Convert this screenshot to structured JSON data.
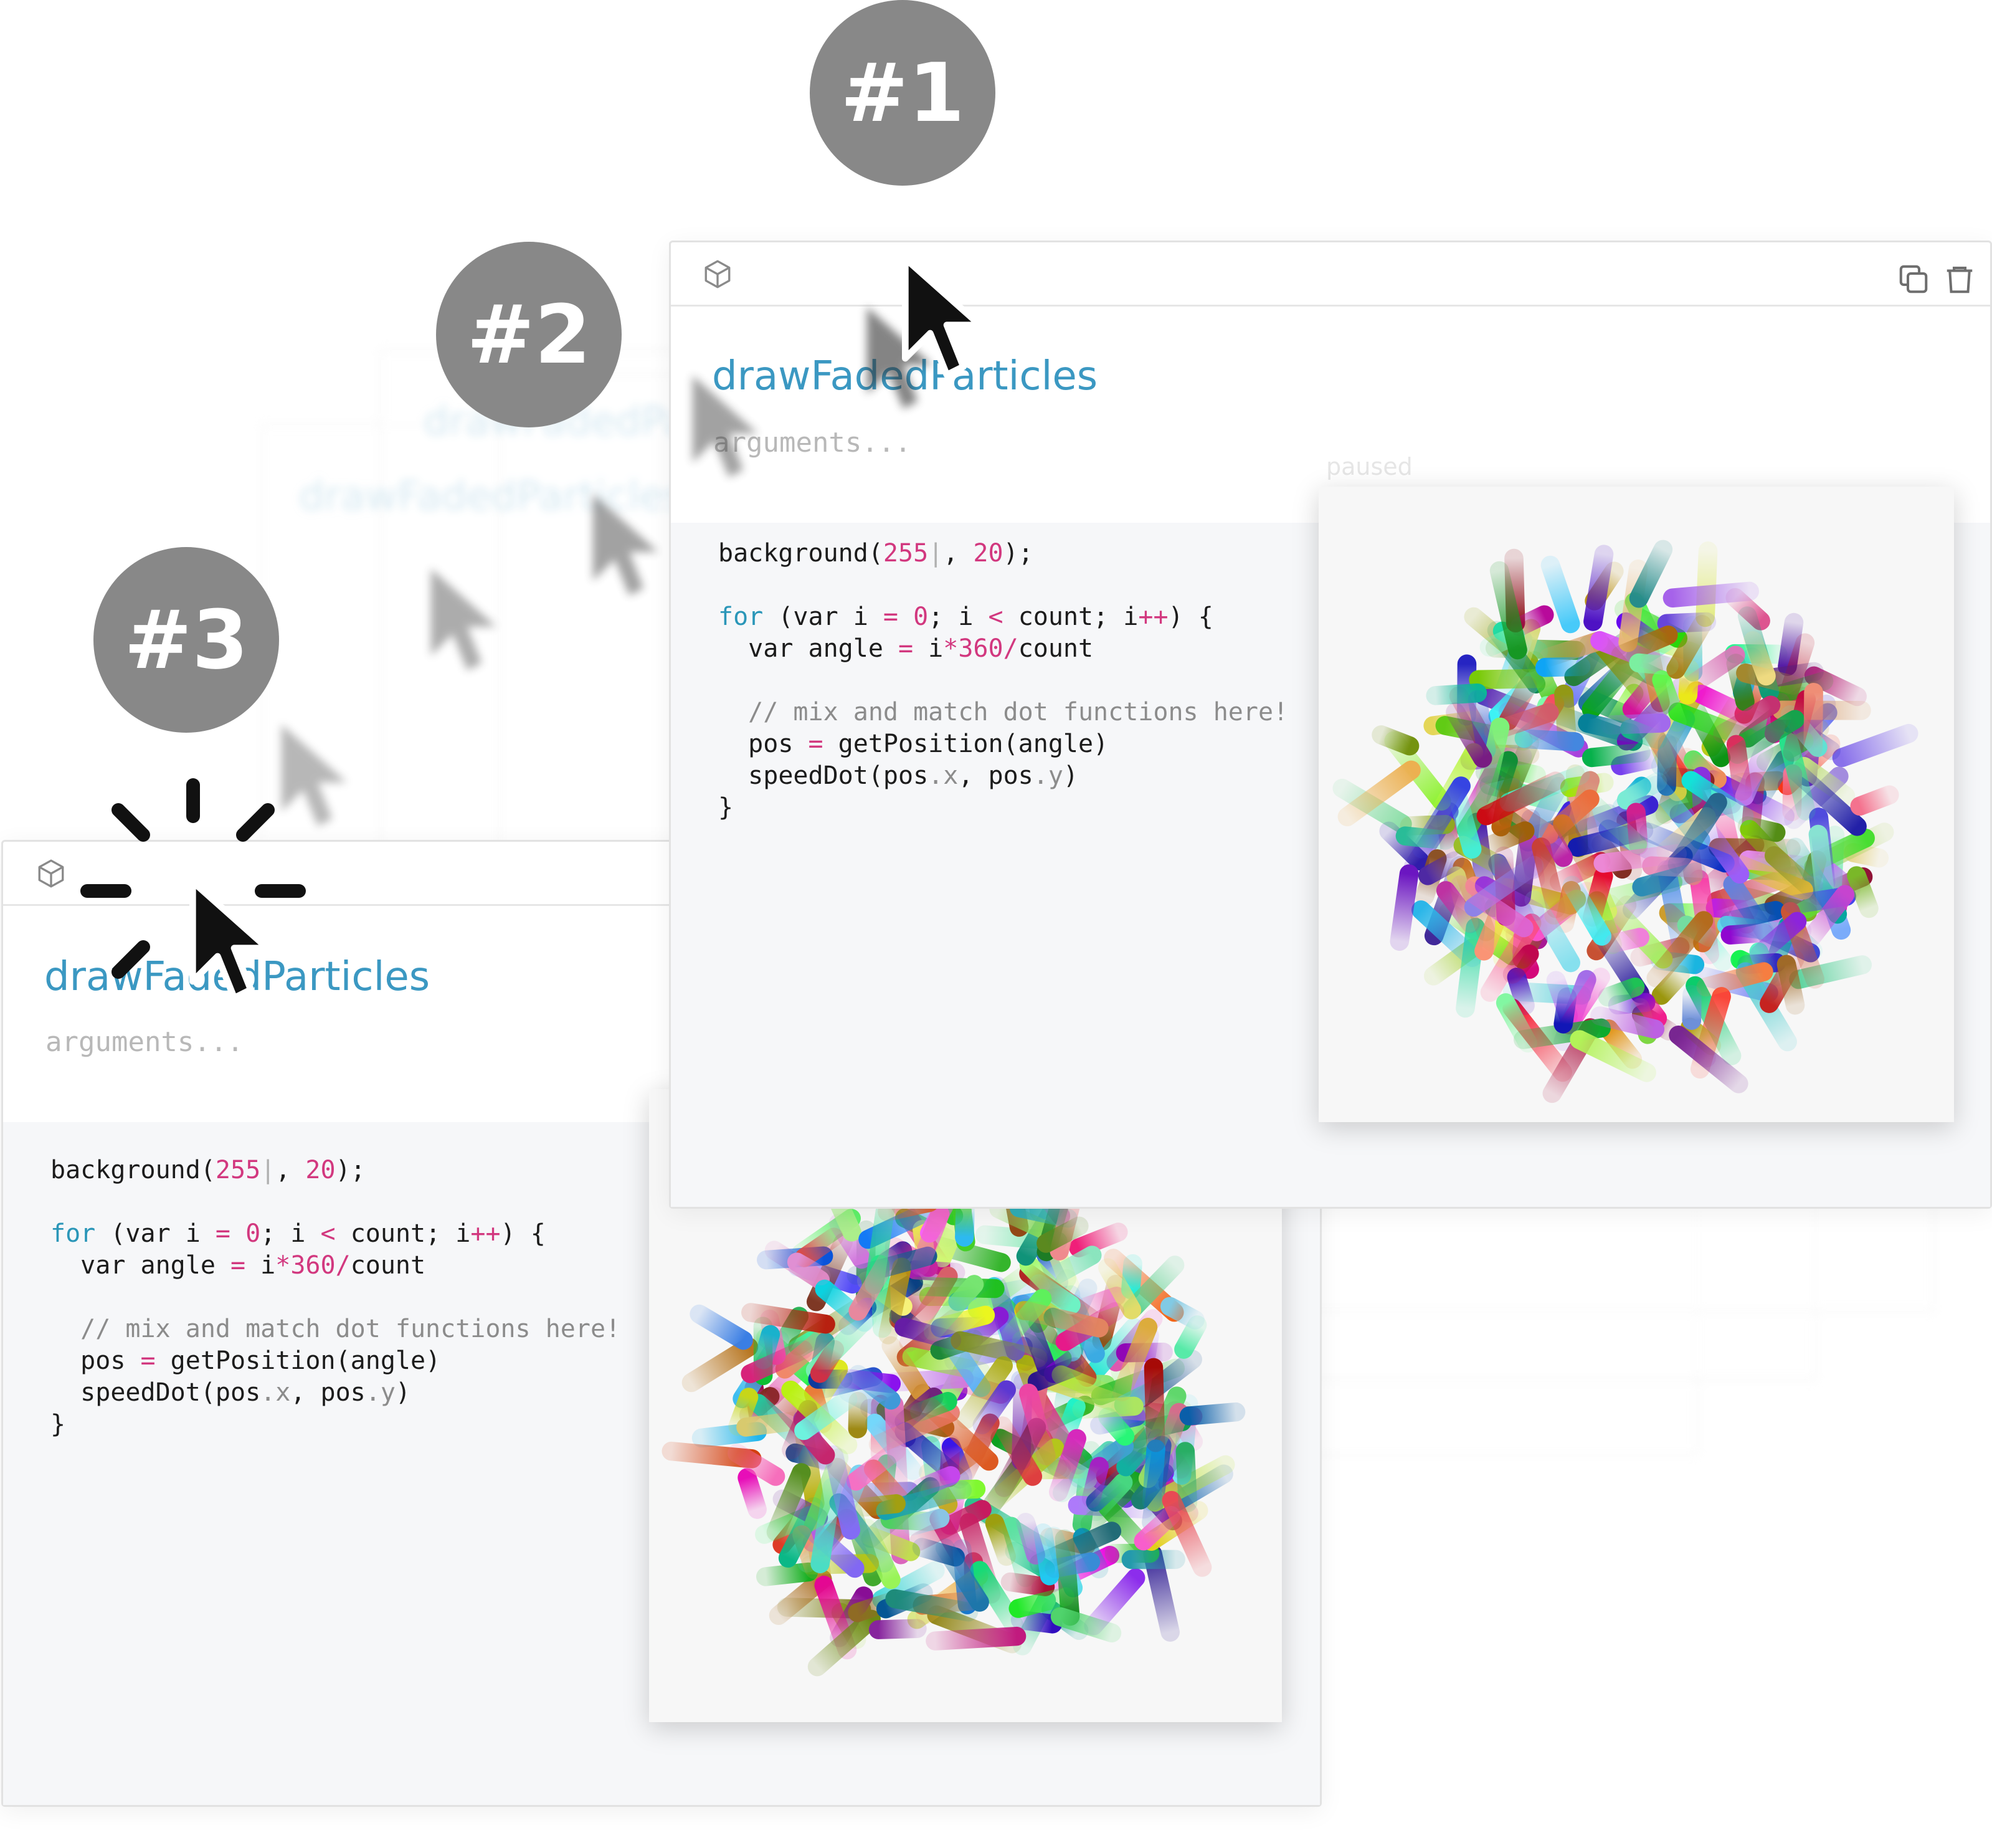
{
  "app": {
    "accent_color": "#3b98c2",
    "badge_color": "#888888"
  },
  "steps": [
    {
      "label": "#1"
    },
    {
      "label": "#2"
    },
    {
      "label": "#3"
    }
  ],
  "card_front": {
    "title": "drawFadedParticles",
    "args_placeholder": "arguments...",
    "status": "paused",
    "toolbar": {
      "left_icon": "cube-icon",
      "duplicate_icon": "duplicate-icon",
      "delete_icon": "trash-icon"
    },
    "code": {
      "l1_fn": "background(",
      "l1_n1": "255",
      "l1_sep": ", ",
      "l1_n2": "20",
      "l1_end": ");",
      "l2_for": "for",
      "l2_a": " (var i ",
      "l2_eq": "=",
      "l2_sp1": " ",
      "l2_zero": "0",
      "l2_b": "; i ",
      "l2_lt": "<",
      "l2_c": " count; i",
      "l2_pp": "++",
      "l2_d": ") {",
      "l3_a": "  var angle ",
      "l3_eq": "=",
      "l3_b": " i",
      "l3_mul": "*",
      "l3_360": "360",
      "l3_div": "/",
      "l3_c": "count",
      "l4_comment": "  // mix and match dot functions here!",
      "l5_a": "  pos ",
      "l5_eq": "=",
      "l5_b": " getPosition(angle)",
      "l6_a": "  speedDot(pos",
      "l6_x": ".x",
      "l6_b": ", pos",
      "l6_y": ".y",
      "l6_c": ")",
      "l7": "}"
    }
  },
  "card_back": {
    "title": "drawFadedParticles",
    "args_placeholder": "arguments..."
  }
}
